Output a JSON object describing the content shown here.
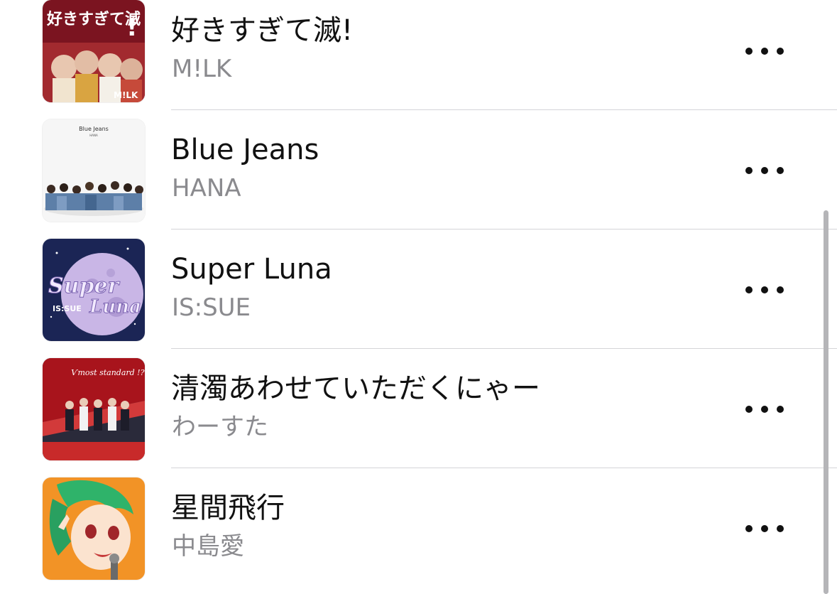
{
  "songs": [
    {
      "title": "好きすぎて滅!",
      "artist": "M!LK",
      "art_text": [
        "好きすぎて滅",
        "!",
        "M!LK"
      ],
      "art_colors": [
        "#7b1420",
        "#c33a3a"
      ]
    },
    {
      "title": "Blue Jeans",
      "artist": "HANA",
      "art_text": [
        "Blue Jeans",
        "HANA"
      ],
      "art_colors": [
        "#f6f6f6",
        "#5d7fa8"
      ]
    },
    {
      "title": "Super Luna",
      "artist": "IS:SUE",
      "art_text": [
        "Super",
        "Luna",
        "IS:SUE"
      ],
      "art_colors": [
        "#1b2555",
        "#c9b6e6"
      ]
    },
    {
      "title": "清濁あわせていただくにゃー",
      "artist": "わーすた",
      "art_text": [
        "Ѵmost standard !?"
      ],
      "art_colors": [
        "#a8141c",
        "#2a2a3a"
      ]
    },
    {
      "title": "星間飛行",
      "artist": "中島愛",
      "art_text": [],
      "art_colors": [
        "#f08a1c",
        "#2fb36a"
      ]
    }
  ],
  "more_icon": "ellipsis-icon"
}
